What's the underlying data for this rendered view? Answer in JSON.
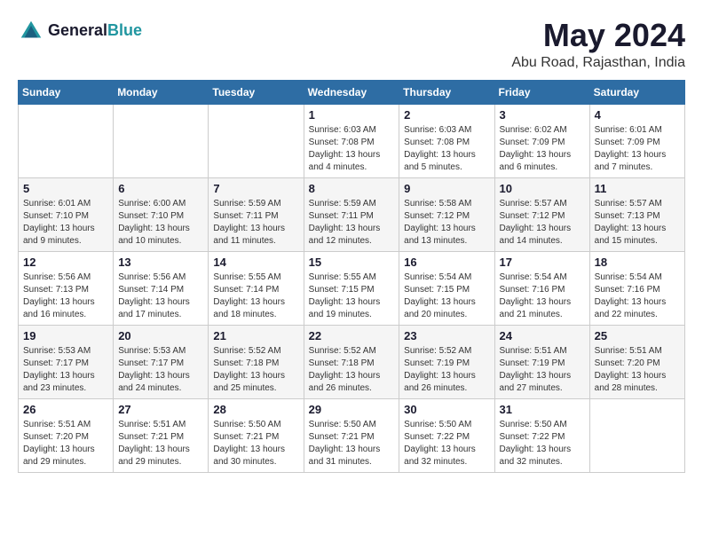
{
  "logo": {
    "line1": "General",
    "line2": "Blue"
  },
  "title": "May 2024",
  "location": "Abu Road, Rajasthan, India",
  "weekdays": [
    "Sunday",
    "Monday",
    "Tuesday",
    "Wednesday",
    "Thursday",
    "Friday",
    "Saturday"
  ],
  "weeks": [
    [
      {
        "day": "",
        "sunrise": "",
        "sunset": "",
        "daylight": ""
      },
      {
        "day": "",
        "sunrise": "",
        "sunset": "",
        "daylight": ""
      },
      {
        "day": "",
        "sunrise": "",
        "sunset": "",
        "daylight": ""
      },
      {
        "day": "1",
        "sunrise": "Sunrise: 6:03 AM",
        "sunset": "Sunset: 7:08 PM",
        "daylight": "Daylight: 13 hours and 4 minutes."
      },
      {
        "day": "2",
        "sunrise": "Sunrise: 6:03 AM",
        "sunset": "Sunset: 7:08 PM",
        "daylight": "Daylight: 13 hours and 5 minutes."
      },
      {
        "day": "3",
        "sunrise": "Sunrise: 6:02 AM",
        "sunset": "Sunset: 7:09 PM",
        "daylight": "Daylight: 13 hours and 6 minutes."
      },
      {
        "day": "4",
        "sunrise": "Sunrise: 6:01 AM",
        "sunset": "Sunset: 7:09 PM",
        "daylight": "Daylight: 13 hours and 7 minutes."
      }
    ],
    [
      {
        "day": "5",
        "sunrise": "Sunrise: 6:01 AM",
        "sunset": "Sunset: 7:10 PM",
        "daylight": "Daylight: 13 hours and 9 minutes."
      },
      {
        "day": "6",
        "sunrise": "Sunrise: 6:00 AM",
        "sunset": "Sunset: 7:10 PM",
        "daylight": "Daylight: 13 hours and 10 minutes."
      },
      {
        "day": "7",
        "sunrise": "Sunrise: 5:59 AM",
        "sunset": "Sunset: 7:11 PM",
        "daylight": "Daylight: 13 hours and 11 minutes."
      },
      {
        "day": "8",
        "sunrise": "Sunrise: 5:59 AM",
        "sunset": "Sunset: 7:11 PM",
        "daylight": "Daylight: 13 hours and 12 minutes."
      },
      {
        "day": "9",
        "sunrise": "Sunrise: 5:58 AM",
        "sunset": "Sunset: 7:12 PM",
        "daylight": "Daylight: 13 hours and 13 minutes."
      },
      {
        "day": "10",
        "sunrise": "Sunrise: 5:57 AM",
        "sunset": "Sunset: 7:12 PM",
        "daylight": "Daylight: 13 hours and 14 minutes."
      },
      {
        "day": "11",
        "sunrise": "Sunrise: 5:57 AM",
        "sunset": "Sunset: 7:13 PM",
        "daylight": "Daylight: 13 hours and 15 minutes."
      }
    ],
    [
      {
        "day": "12",
        "sunrise": "Sunrise: 5:56 AM",
        "sunset": "Sunset: 7:13 PM",
        "daylight": "Daylight: 13 hours and 16 minutes."
      },
      {
        "day": "13",
        "sunrise": "Sunrise: 5:56 AM",
        "sunset": "Sunset: 7:14 PM",
        "daylight": "Daylight: 13 hours and 17 minutes."
      },
      {
        "day": "14",
        "sunrise": "Sunrise: 5:55 AM",
        "sunset": "Sunset: 7:14 PM",
        "daylight": "Daylight: 13 hours and 18 minutes."
      },
      {
        "day": "15",
        "sunrise": "Sunrise: 5:55 AM",
        "sunset": "Sunset: 7:15 PM",
        "daylight": "Daylight: 13 hours and 19 minutes."
      },
      {
        "day": "16",
        "sunrise": "Sunrise: 5:54 AM",
        "sunset": "Sunset: 7:15 PM",
        "daylight": "Daylight: 13 hours and 20 minutes."
      },
      {
        "day": "17",
        "sunrise": "Sunrise: 5:54 AM",
        "sunset": "Sunset: 7:16 PM",
        "daylight": "Daylight: 13 hours and 21 minutes."
      },
      {
        "day": "18",
        "sunrise": "Sunrise: 5:54 AM",
        "sunset": "Sunset: 7:16 PM",
        "daylight": "Daylight: 13 hours and 22 minutes."
      }
    ],
    [
      {
        "day": "19",
        "sunrise": "Sunrise: 5:53 AM",
        "sunset": "Sunset: 7:17 PM",
        "daylight": "Daylight: 13 hours and 23 minutes."
      },
      {
        "day": "20",
        "sunrise": "Sunrise: 5:53 AM",
        "sunset": "Sunset: 7:17 PM",
        "daylight": "Daylight: 13 hours and 24 minutes."
      },
      {
        "day": "21",
        "sunrise": "Sunrise: 5:52 AM",
        "sunset": "Sunset: 7:18 PM",
        "daylight": "Daylight: 13 hours and 25 minutes."
      },
      {
        "day": "22",
        "sunrise": "Sunrise: 5:52 AM",
        "sunset": "Sunset: 7:18 PM",
        "daylight": "Daylight: 13 hours and 26 minutes."
      },
      {
        "day": "23",
        "sunrise": "Sunrise: 5:52 AM",
        "sunset": "Sunset: 7:19 PM",
        "daylight": "Daylight: 13 hours and 26 minutes."
      },
      {
        "day": "24",
        "sunrise": "Sunrise: 5:51 AM",
        "sunset": "Sunset: 7:19 PM",
        "daylight": "Daylight: 13 hours and 27 minutes."
      },
      {
        "day": "25",
        "sunrise": "Sunrise: 5:51 AM",
        "sunset": "Sunset: 7:20 PM",
        "daylight": "Daylight: 13 hours and 28 minutes."
      }
    ],
    [
      {
        "day": "26",
        "sunrise": "Sunrise: 5:51 AM",
        "sunset": "Sunset: 7:20 PM",
        "daylight": "Daylight: 13 hours and 29 minutes."
      },
      {
        "day": "27",
        "sunrise": "Sunrise: 5:51 AM",
        "sunset": "Sunset: 7:21 PM",
        "daylight": "Daylight: 13 hours and 29 minutes."
      },
      {
        "day": "28",
        "sunrise": "Sunrise: 5:50 AM",
        "sunset": "Sunset: 7:21 PM",
        "daylight": "Daylight: 13 hours and 30 minutes."
      },
      {
        "day": "29",
        "sunrise": "Sunrise: 5:50 AM",
        "sunset": "Sunset: 7:21 PM",
        "daylight": "Daylight: 13 hours and 31 minutes."
      },
      {
        "day": "30",
        "sunrise": "Sunrise: 5:50 AM",
        "sunset": "Sunset: 7:22 PM",
        "daylight": "Daylight: 13 hours and 32 minutes."
      },
      {
        "day": "31",
        "sunrise": "Sunrise: 5:50 AM",
        "sunset": "Sunset: 7:22 PM",
        "daylight": "Daylight: 13 hours and 32 minutes."
      },
      {
        "day": "",
        "sunrise": "",
        "sunset": "",
        "daylight": ""
      }
    ]
  ]
}
